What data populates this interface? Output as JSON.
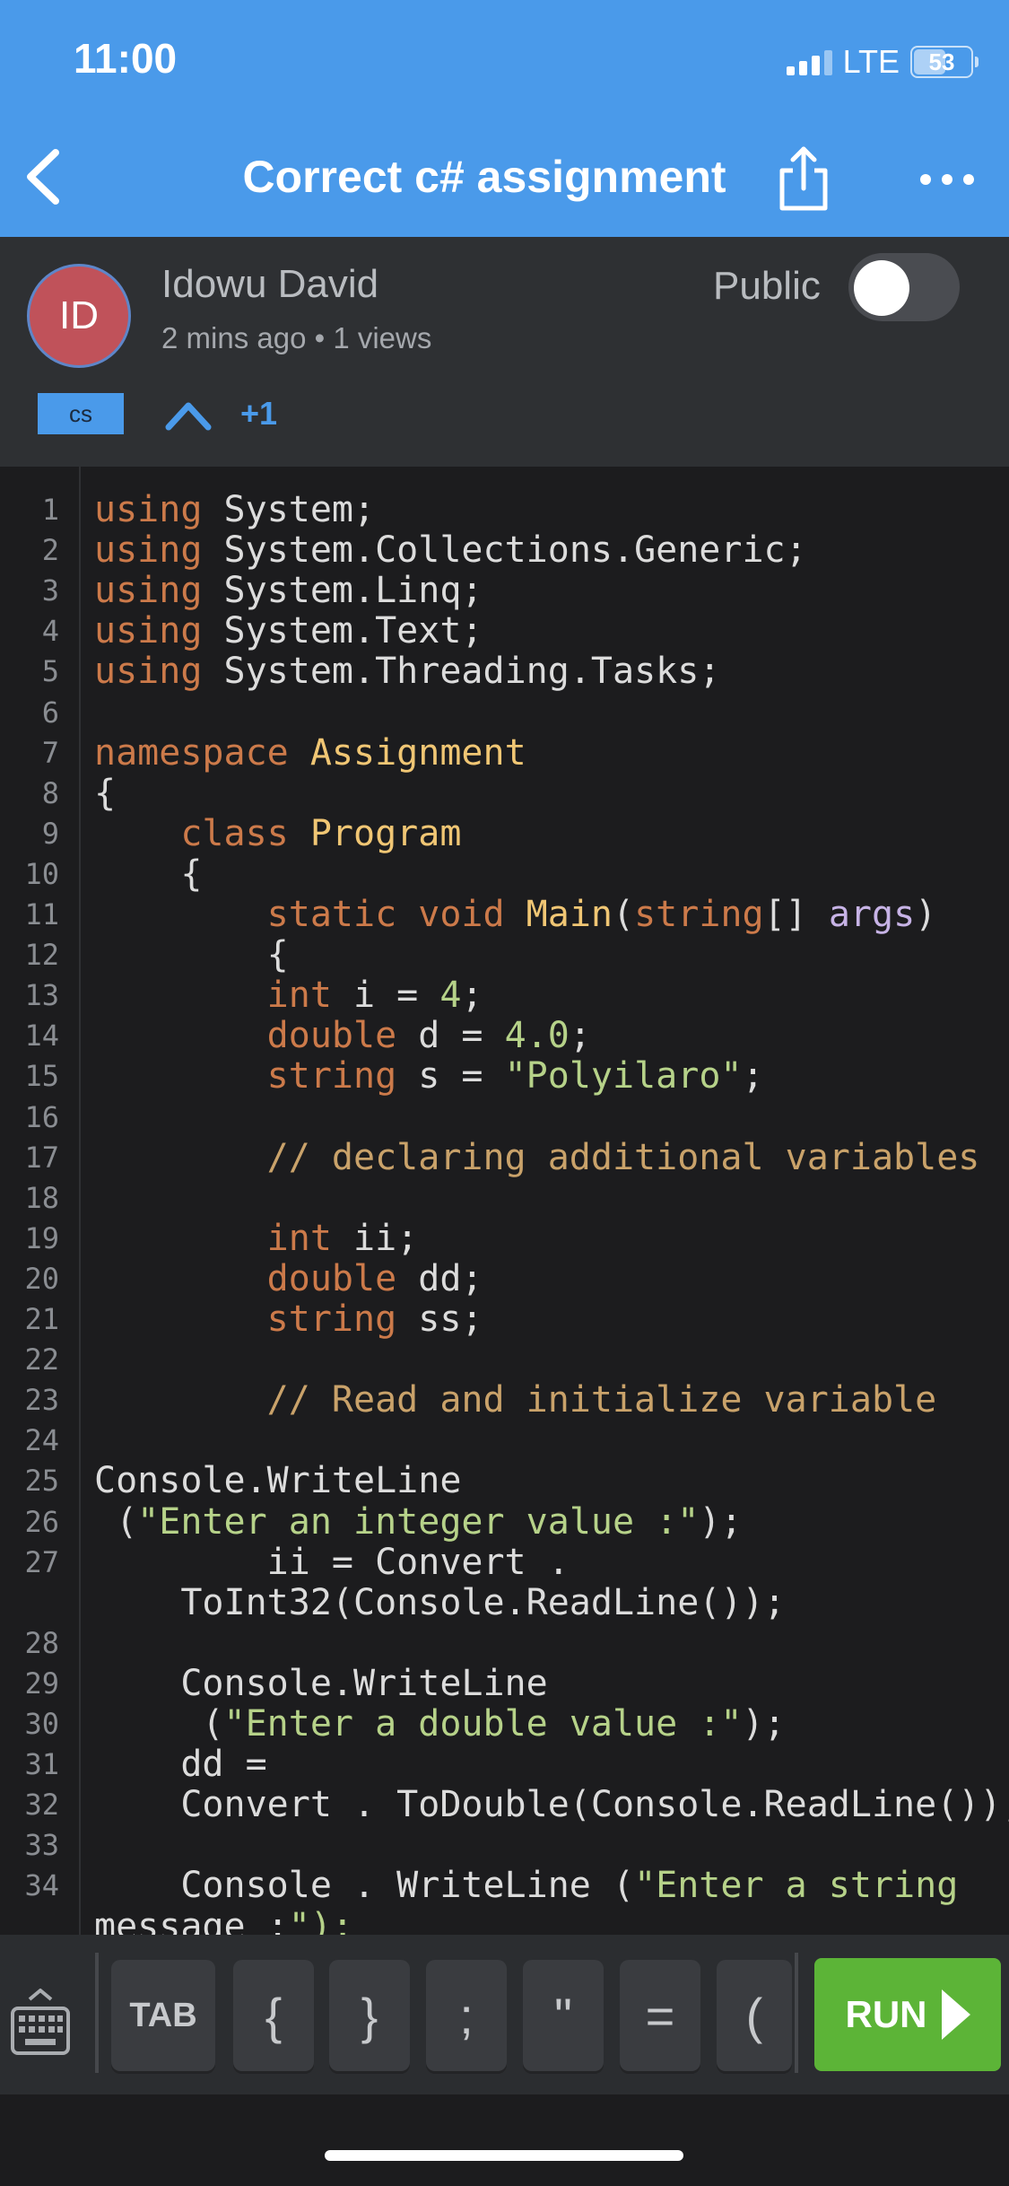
{
  "status_bar": {
    "time": "11:00",
    "network": "LTE",
    "battery": "53"
  },
  "nav": {
    "title": "Correct c# assignment"
  },
  "post": {
    "avatar_initials": "ID",
    "author": "Idowu David",
    "meta": "2 mins ago • 1 views",
    "visibility_label": "Public",
    "visibility_public": false,
    "language": "cs",
    "votes": "+1"
  },
  "code": {
    "lines": [
      {
        "n": "1",
        "t": "using System;"
      },
      {
        "n": "2",
        "t": "using System.Collections.Generic;"
      },
      {
        "n": "3",
        "t": "using System.Linq;"
      },
      {
        "n": "4",
        "t": "using System.Text;"
      },
      {
        "n": "5",
        "t": "using System.Threading.Tasks;"
      },
      {
        "n": "6",
        "t": ""
      },
      {
        "n": "7",
        "t": "namespace Assignment"
      },
      {
        "n": "8",
        "t": "{"
      },
      {
        "n": "9",
        "t": "    class Program"
      },
      {
        "n": "10",
        "t": "    {"
      },
      {
        "n": "11",
        "t": "        static void Main(string[] args)"
      },
      {
        "n": "12",
        "t": "        {"
      },
      {
        "n": "13",
        "t": "        int i = 4;"
      },
      {
        "n": "14",
        "t": "        double d = 4.0;"
      },
      {
        "n": "15",
        "t": "        string s = \"Polyilaro\";"
      },
      {
        "n": "16",
        "t": ""
      },
      {
        "n": "17",
        "t": "        // declaring additional variables"
      },
      {
        "n": "18",
        "t": ""
      },
      {
        "n": "19",
        "t": "        int ii;"
      },
      {
        "n": "20",
        "t": "        double dd;"
      },
      {
        "n": "21",
        "t": "        string ss;"
      },
      {
        "n": "22",
        "t": ""
      },
      {
        "n": "23",
        "t": "        // Read and initialize variable"
      },
      {
        "n": "24",
        "t": ""
      },
      {
        "n": "25",
        "t": "Console.WriteLine"
      },
      {
        "n": "26",
        "t": " (\"Enter an integer value :\");"
      },
      {
        "n": "27",
        "t": "        ii = Convert ."
      },
      {
        "n": "",
        "t": "    ToInt32(Console.ReadLine());"
      },
      {
        "n": "28",
        "t": ""
      },
      {
        "n": "29",
        "t": "    Console.WriteLine"
      },
      {
        "n": "30",
        "t": "     (\"Enter a double value :\");"
      },
      {
        "n": "31",
        "t": "    dd ="
      },
      {
        "n": "32",
        "t": "    Convert . ToDouble(Console.ReadLine());"
      },
      {
        "n": "33",
        "t": ""
      },
      {
        "n": "34",
        "t": "    Console . WriteLine (\"Enter a string"
      },
      {
        "n": "",
        "t": "message :\");"
      }
    ]
  },
  "toolbar": {
    "keys": [
      "TAB",
      "{",
      "}",
      ";",
      "\"",
      "=",
      "("
    ],
    "run_label": "RUN"
  }
}
